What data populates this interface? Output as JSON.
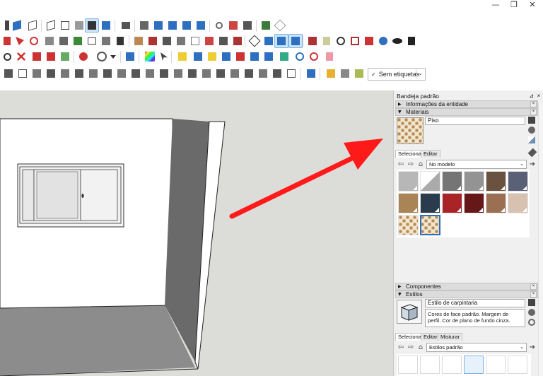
{
  "window": {
    "minimize": "—",
    "restore": "❐",
    "close": "✕"
  },
  "toolbar": {
    "tag_selector": "Sem etiquetas",
    "tag_check": "✓",
    "dropdown_arrow": "⌄"
  },
  "tray": {
    "title": "Bandeja padrão",
    "pin": "⊿",
    "close": "×",
    "panels": {
      "entity_info": "Informações da entidade",
      "materials": "Materiais",
      "components": "Componentes",
      "styles": "Estilos"
    },
    "materials": {
      "name": "Piso",
      "tabs": [
        "Selecionar",
        "Editar"
      ],
      "collection": "No modelo",
      "swatches": [
        {
          "color": "#b7b7b7"
        },
        {
          "color": "split"
        },
        {
          "color": "#757575"
        },
        {
          "color": "#939393"
        },
        {
          "color": "#6a5240"
        },
        {
          "color": "#5a6076"
        },
        {
          "color": "#a88457"
        },
        {
          "color": "#2a3b4e"
        },
        {
          "color": "#a82427"
        },
        {
          "color": "#661717"
        },
        {
          "color": "#9b6f52"
        },
        {
          "color": "#d7c2b1"
        },
        {
          "color": "texture"
        },
        {
          "color": "texture-selected"
        }
      ]
    },
    "styles": {
      "name": "Estilo de carpintaria",
      "description": "Cores de face padrão. Margem de perfil. Cor de plano de fundo cinza.",
      "tabs": [
        "Selecionar",
        "Editar",
        "Misturar"
      ],
      "collection": "Estilos padrão"
    }
  },
  "colors": {
    "accent": "#2e6fbf",
    "arrow": "#ff1a1a",
    "viewport_bg": "#dcdcd8",
    "wall_dark": "#6a6a6a",
    "floor": "#8c8c8c"
  }
}
